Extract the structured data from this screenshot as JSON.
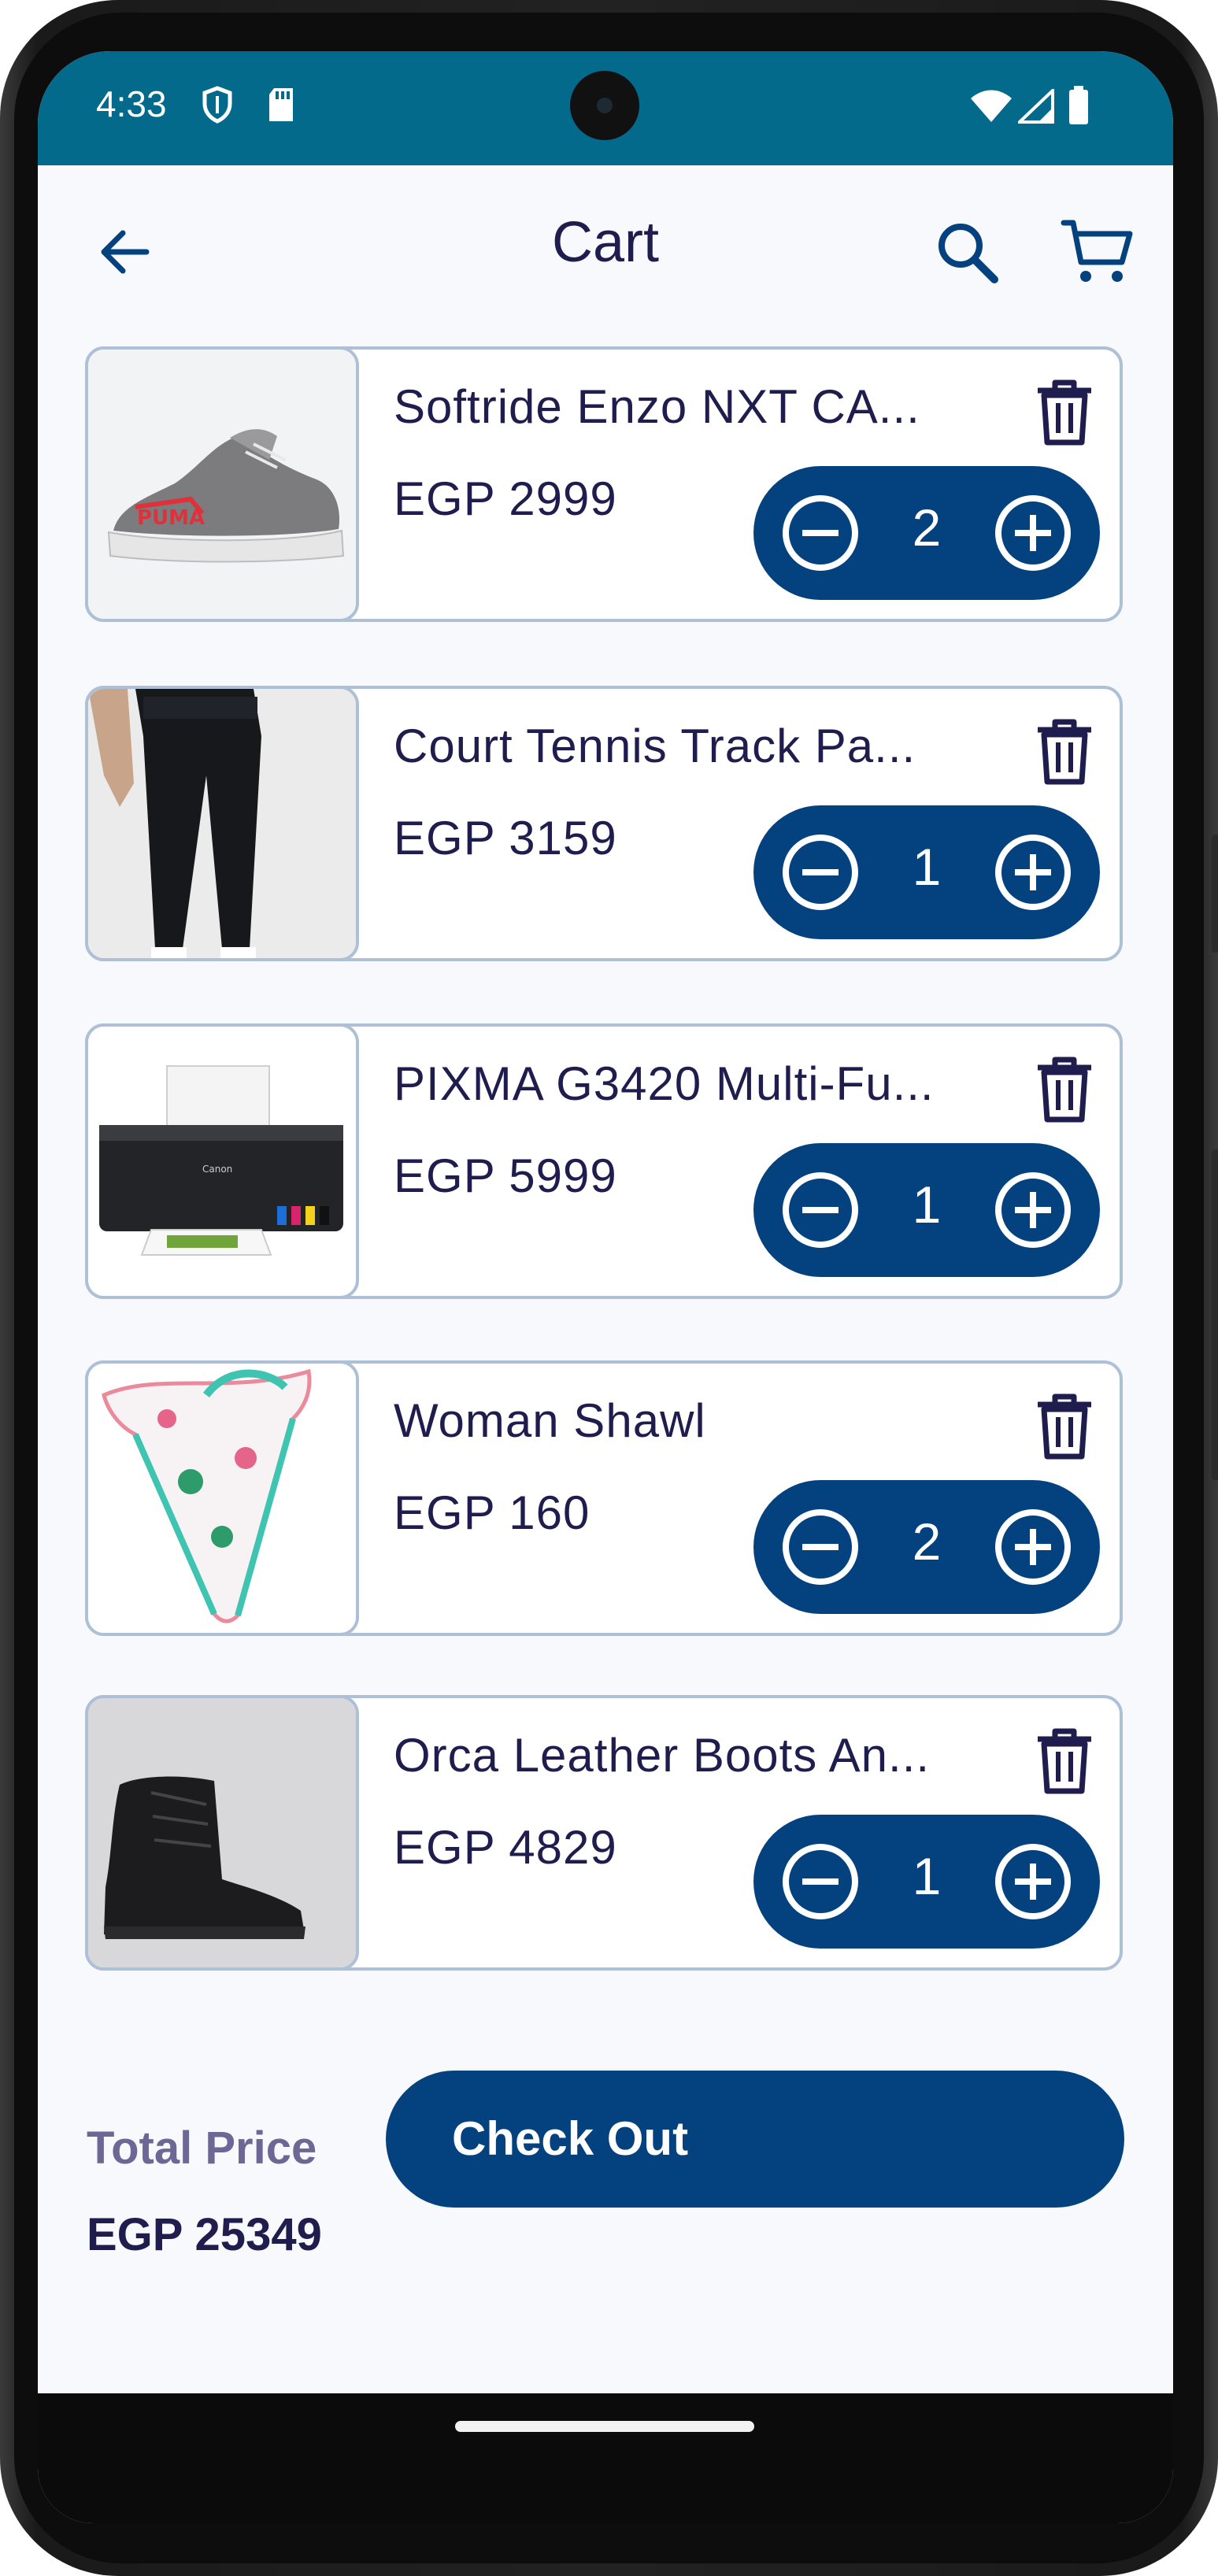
{
  "status": {
    "time": "4:33"
  },
  "header": {
    "title": "Cart"
  },
  "cart": {
    "items": [
      {
        "name": "Softride Enzo NXT CA...",
        "price": "EGP 2999",
        "quantity": "2",
        "image": "sneaker"
      },
      {
        "name": "Court Tennis Track Pa...",
        "price": "EGP 3159",
        "quantity": "1",
        "image": "track-pants"
      },
      {
        "name": "PIXMA G3420 Multi-Fu...",
        "price": "EGP 5999",
        "quantity": "1",
        "image": "printer"
      },
      {
        "name": "Woman Shawl",
        "price": "EGP 160",
        "quantity": "2",
        "image": "shawl"
      },
      {
        "name": "Orca Leather Boots An...",
        "price": "EGP 4829",
        "quantity": "1",
        "image": "boots"
      }
    ]
  },
  "footer": {
    "total_label": "Total Price",
    "total_value": "EGP 25349",
    "checkout_label": "Check Out"
  },
  "colors": {
    "status_bar": "#046a8c",
    "primary": "#03427e",
    "text": "#1f1d4d",
    "card_border": "#aec0d6",
    "background": "#f8f9fc"
  }
}
